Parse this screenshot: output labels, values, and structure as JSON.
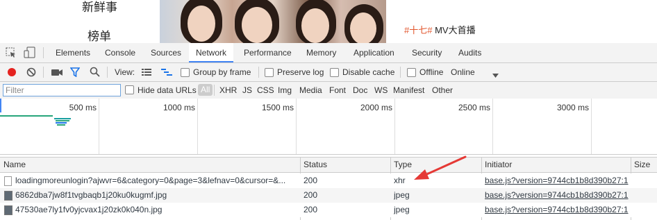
{
  "web": {
    "nav1": "新鲜事",
    "nav2": "榜单",
    "mv_tag": "#十七#",
    "mv_text": " MV大首播"
  },
  "devtools": {
    "tabs": [
      "Elements",
      "Console",
      "Sources",
      "Network",
      "Performance",
      "Memory",
      "Application",
      "Security",
      "Audits"
    ],
    "active_tab": "Network"
  },
  "toolbar": {
    "view_label": "View:",
    "group_by_frame": "Group by frame",
    "preserve_log": "Preserve log",
    "disable_cache": "Disable cache",
    "offline": "Offline",
    "throttle": "Online"
  },
  "filter": {
    "placeholder": "Filter",
    "hide_data_urls": "Hide data URLs",
    "types": [
      "All",
      "XHR",
      "JS",
      "CSS",
      "Img",
      "Media",
      "Font",
      "Doc",
      "WS",
      "Manifest",
      "Other"
    ]
  },
  "timeline": {
    "ticks": [
      "500 ms",
      "1000 ms",
      "1500 ms",
      "2000 ms",
      "2500 ms",
      "3000 ms"
    ]
  },
  "table": {
    "columns": [
      "Name",
      "Status",
      "Type",
      "Initiator",
      "Size"
    ],
    "rows": [
      {
        "name": "loadingmoreunlogin?ajwvr=6&category=0&page=3&lefnav=0&cursor=&...",
        "status": "200",
        "type": "xhr",
        "initiator": "base.js?version=9744cb1b8d390b27:1"
      },
      {
        "name": "6862dba7jw8f1tvgbaqb1j20ku0kugmf.jpg",
        "status": "200",
        "type": "jpeg",
        "initiator": "base.js?version=9744cb1b8d390b27:1"
      },
      {
        "name": "47530ae7ly1fv0yjcvax1j20zk0k040n.jpg",
        "status": "200",
        "type": "jpeg",
        "initiator": "base.js?version=9744cb1b8d390b27:1"
      }
    ]
  },
  "colors": {
    "accent": "#4285f4",
    "record": "#e52320",
    "annotation_arrow": "#e53935",
    "tag": "#e2552c"
  }
}
